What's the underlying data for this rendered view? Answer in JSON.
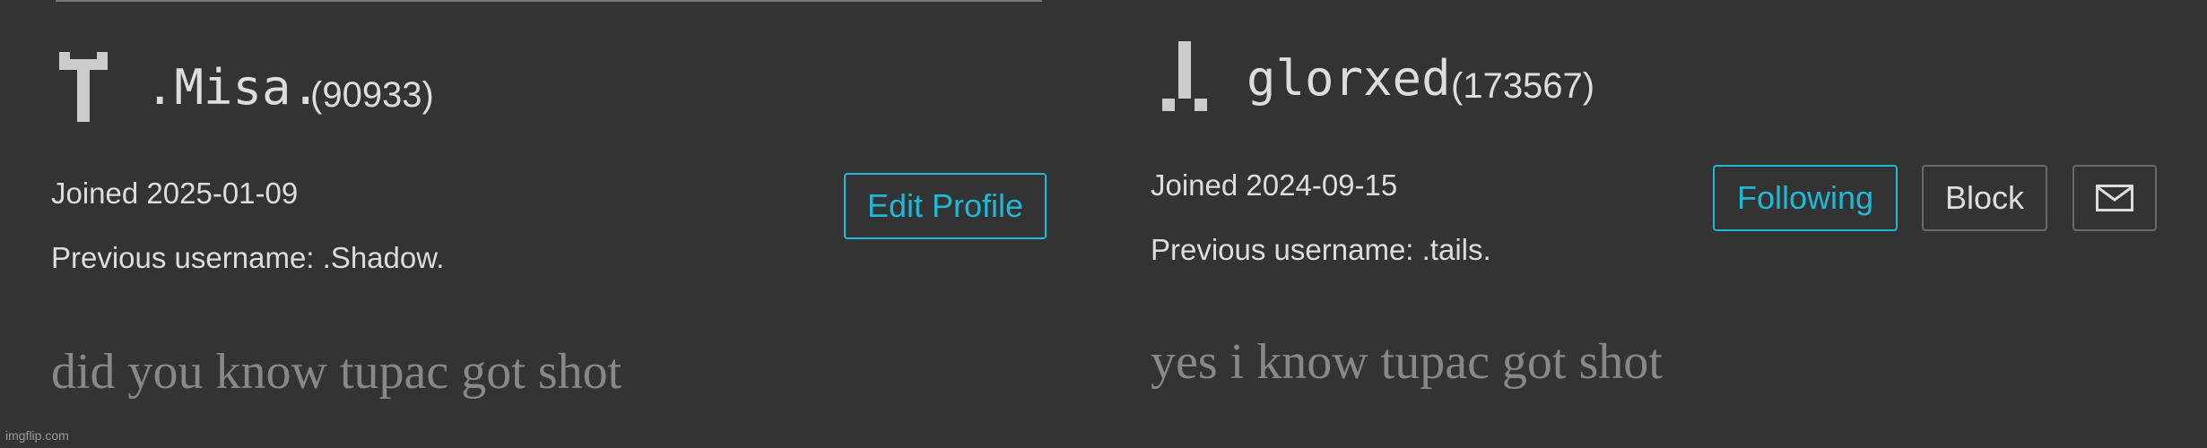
{
  "colors": {
    "background": "#333333",
    "text": "#dddddd",
    "bio_text": "#888888",
    "accent": "#1fb8d6",
    "button_border": "#6a6a6a"
  },
  "left_profile": {
    "avatar_icon": "pixel-avatar-icon",
    "username": ".Misa.",
    "points": "(90933)",
    "joined": "Joined 2025-01-09",
    "previous_username": "Previous username: .Shadow.",
    "bio": "did you know tupac got shot",
    "edit_profile_label": "Edit Profile"
  },
  "right_profile": {
    "avatar_icon": "pixel-avatar-icon",
    "username": "glorxed",
    "points": "(173567)",
    "joined": "Joined 2024-09-15",
    "previous_username": "Previous username: .tails.",
    "bio": "yes i know tupac got shot",
    "following_label": "Following",
    "block_label": "Block",
    "message_icon": "envelope-icon"
  },
  "watermark": "imgflip.com"
}
